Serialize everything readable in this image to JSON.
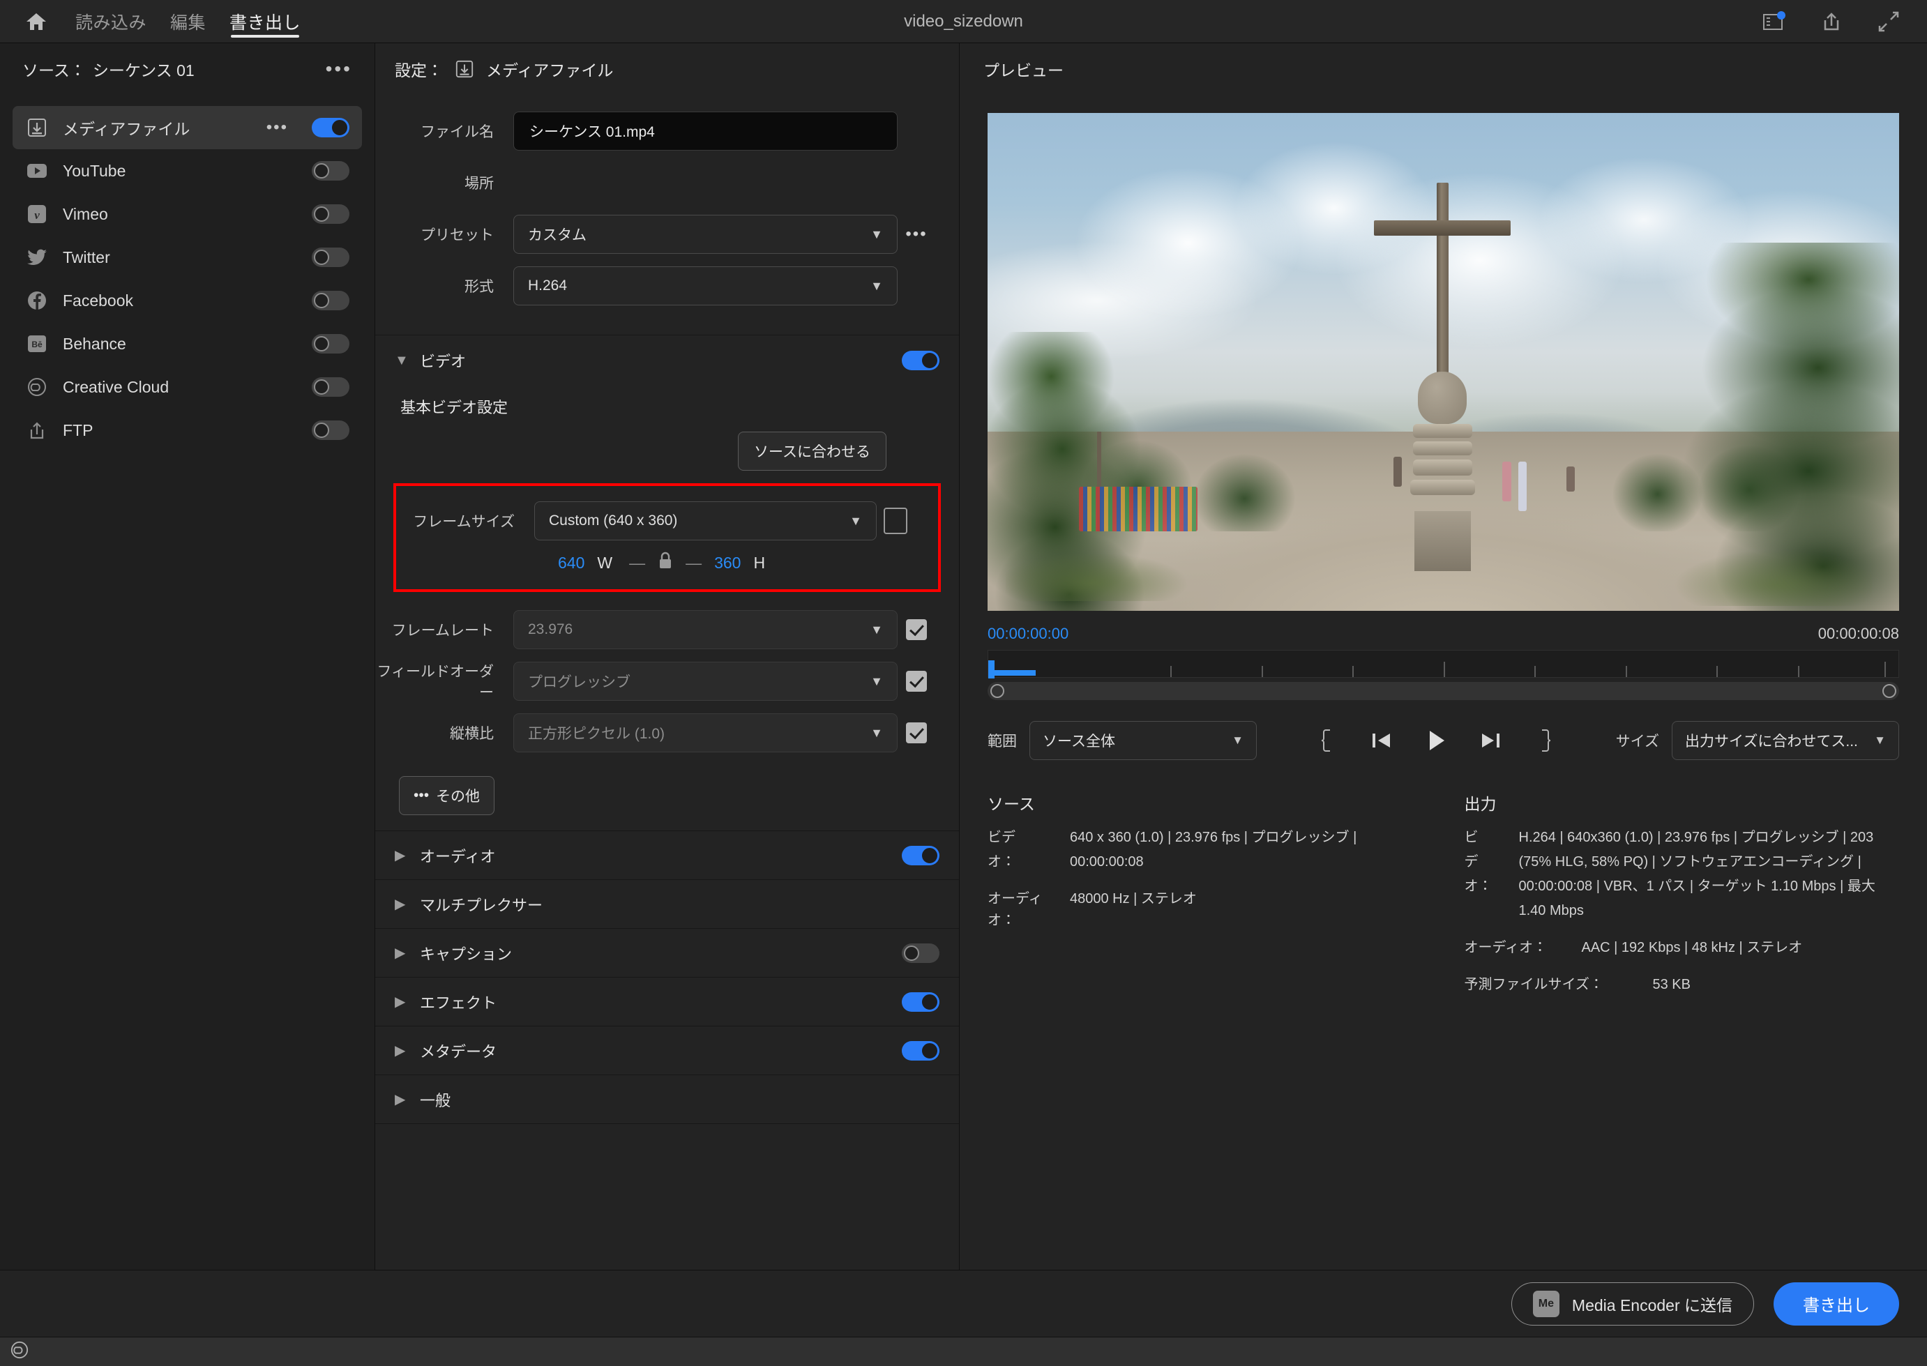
{
  "topbar": {
    "home_icon": "home-icon",
    "tabs": [
      {
        "label": "読み込み",
        "active": false
      },
      {
        "label": "編集",
        "active": false
      },
      {
        "label": "書き出し",
        "active": true
      }
    ],
    "window_title": "video_sizedown",
    "icons": [
      "workspace-panel-icon",
      "share-upload-icon",
      "fullscreen-expand-icon"
    ]
  },
  "sidebar": {
    "header_label": "ソース：",
    "header_value": "シーケンス 01",
    "header_menu": "•••",
    "items": [
      {
        "label": "メディアファイル",
        "icon": "media-file-icon",
        "toggle": true,
        "selected": true,
        "menu": "•••"
      },
      {
        "label": "YouTube",
        "icon": "youtube-icon",
        "toggle": false,
        "selected": false
      },
      {
        "label": "Vimeo",
        "icon": "vimeo-icon",
        "toggle": false,
        "selected": false
      },
      {
        "label": "Twitter",
        "icon": "twitter-icon",
        "toggle": false,
        "selected": false
      },
      {
        "label": "Facebook",
        "icon": "facebook-icon",
        "toggle": false,
        "selected": false
      },
      {
        "label": "Behance",
        "icon": "behance-icon",
        "toggle": false,
        "selected": false
      },
      {
        "label": "Creative Cloud",
        "icon": "creative-cloud-icon",
        "toggle": false,
        "selected": false
      },
      {
        "label": "FTP",
        "icon": "ftp-upload-icon",
        "toggle": false,
        "selected": false
      }
    ]
  },
  "settings": {
    "header_label": "設定：",
    "header_value": "メディアファイル",
    "header_icon": "media-file-icon",
    "filename": {
      "label": "ファイル名",
      "value": "シーケンス 01.mp4"
    },
    "location": {
      "label": "場所",
      "value": ""
    },
    "preset": {
      "label": "プリセット",
      "value": "カスタム",
      "menu": "•••"
    },
    "format": {
      "label": "形式",
      "value": "H.264"
    },
    "video_section": {
      "title": "ビデオ",
      "toggle": true,
      "subtitle": "基本ビデオ設定",
      "match_source_button": "ソースに合わせる",
      "frame_size": {
        "label": "フレームサイズ",
        "value": "Custom (640 x 360)",
        "width": "640",
        "width_unit": "W",
        "height": "360",
        "height_unit": "H",
        "lock_icon": "lock-closed-icon",
        "aspect_icon": "aspect-ratio-icon",
        "highlight_color": "#ff0000"
      },
      "frame_rate": {
        "label": "フレームレート",
        "value": "23.976",
        "checked": true
      },
      "field_order": {
        "label": "フィールドオーダー",
        "value": "プログレッシブ",
        "checked": true
      },
      "aspect": {
        "label": "縦横比",
        "value": "正方形ピクセル (1.0)",
        "checked": true
      },
      "more_button": "その他"
    },
    "collapsibles": [
      {
        "label": "オーディオ",
        "toggle": true,
        "has_toggle": true
      },
      {
        "label": "マルチプレクサー",
        "toggle": false,
        "has_toggle": false
      },
      {
        "label": "キャプション",
        "toggle": false,
        "has_toggle": true
      },
      {
        "label": "エフェクト",
        "toggle": true,
        "has_toggle": true
      },
      {
        "label": "メタデータ",
        "toggle": true,
        "has_toggle": true
      },
      {
        "label": "一般",
        "toggle": false,
        "has_toggle": false
      }
    ]
  },
  "preview": {
    "title": "プレビュー",
    "timeline": {
      "start": "00:00:00:00",
      "end": "00:00:00:08"
    },
    "controls": {
      "range_label": "範囲",
      "range_value": "ソース全体",
      "size_label": "サイズ",
      "size_value": "出力サイズに合わせてス...",
      "transport": [
        "in-point-icon",
        "step-back-icon",
        "play-icon",
        "step-forward-icon",
        "out-point-icon"
      ]
    },
    "source": {
      "title": "ソース",
      "rows": [
        {
          "key": "ビデ",
          "value": "640 x 360 (1.0) | 23.976 fps | プログレッシブ |"
        },
        {
          "key": "オ：",
          "value": "00:00:00:08"
        },
        {
          "key": "オーディオ：",
          "value": "48000 Hz | ステレオ"
        }
      ]
    },
    "output": {
      "title": "出力",
      "rows": [
        {
          "key": "ビ",
          "value": "H.264 | 640x360 (1.0) | 23.976 fps | プログレッシブ | 203"
        },
        {
          "key": "デ",
          "value": "(75% HLG, 58% PQ) | ソフトウェアエンコーディング |"
        },
        {
          "key": "オ：",
          "value": "00:00:00:08 | VBR、1 パス | ターゲット 1.10 Mbps | 最大"
        },
        {
          "key": "",
          "value": "1.40 Mbps"
        },
        {
          "key": "オーディオ：",
          "value": "AAC | 192 Kbps | 48 kHz | ステレオ"
        },
        {
          "key": "予測ファイルサイズ：",
          "value": "53 KB"
        }
      ]
    }
  },
  "bottombar": {
    "media_encoder_button": "Media Encoder に送信",
    "media_encoder_badge": "Me",
    "export_button": "書き出し",
    "export_button_color": "#2a7bf6"
  },
  "statusbar": {
    "icon": "creative-cloud-icon"
  }
}
